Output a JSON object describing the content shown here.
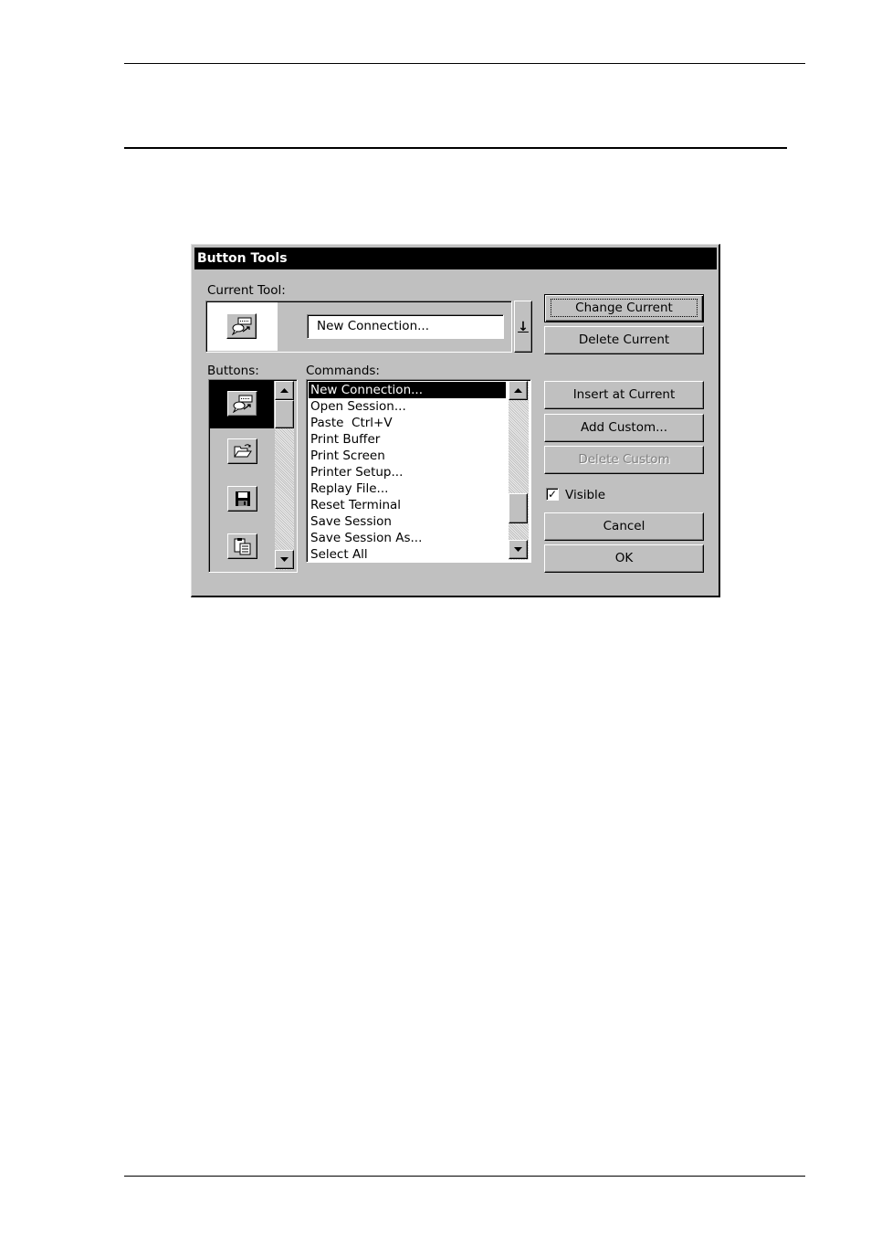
{
  "dialog": {
    "title": "Button Tools",
    "current_tool": {
      "label": "Current Tool:",
      "value": "New Connection...",
      "dropdown_glyph": "↓",
      "icon": "new-connection-icon"
    },
    "buttons_label": "Buttons:",
    "commands_label": "Commands:",
    "button_icons": [
      "new-connection-icon",
      "open-folder-icon",
      "floppy-disk-icon",
      "paste-icon"
    ],
    "commands": [
      "New Connection...",
      "Open Session...",
      "Paste  Ctrl+V",
      "Print Buffer",
      "Print Screen",
      "Printer Setup...",
      "Replay File...",
      "Reset Terminal",
      "Save Session",
      "Save Session As...",
      "Select All"
    ],
    "selected_command": "New Connection...",
    "actions": {
      "change_current": "Change Current",
      "delete_current": "Delete Current",
      "insert_at_current": "Insert at Current",
      "add_custom": "Add Custom...",
      "delete_custom": "Delete Custom",
      "cancel": "Cancel",
      "ok": "OK"
    },
    "visible": {
      "label": "Visible",
      "checked": true,
      "check_glyph": "✓"
    }
  }
}
